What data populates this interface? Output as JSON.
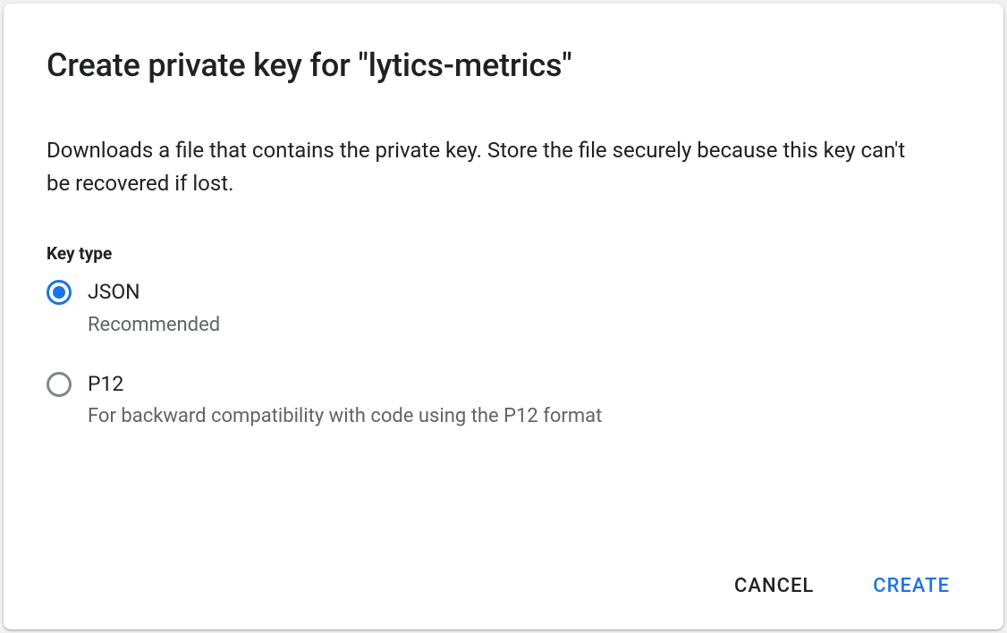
{
  "dialog": {
    "title": "Create private key for \"lytics-metrics\"",
    "description": "Downloads a file that contains the private key. Store the file securely because this key can't be recovered if lost.",
    "section_label": "Key type",
    "options": [
      {
        "label": "JSON",
        "sublabel": "Recommended",
        "selected": true
      },
      {
        "label": "P12",
        "sublabel": "For backward compatibility with code using the P12 format",
        "selected": false
      }
    ],
    "actions": {
      "cancel": "CANCEL",
      "create": "CREATE"
    }
  }
}
